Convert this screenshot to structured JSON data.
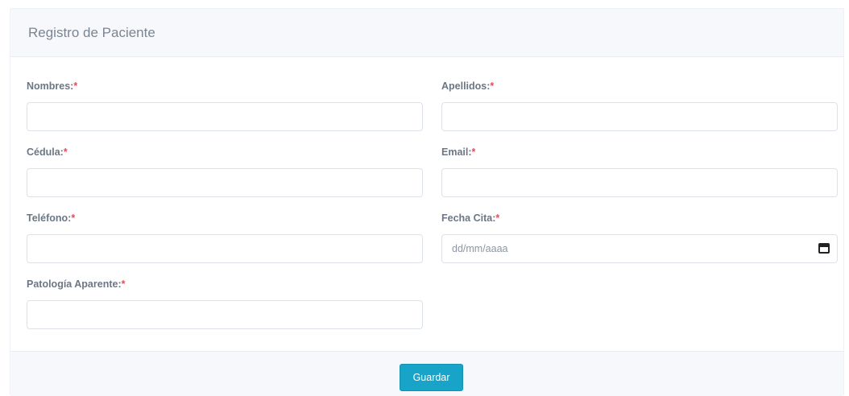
{
  "header": {
    "title": "Registro de Paciente"
  },
  "form": {
    "nombres": {
      "label": "Nombres:",
      "required_mark": "*",
      "value": ""
    },
    "apellidos": {
      "label": "Apellidos:",
      "required_mark": "*",
      "value": ""
    },
    "cedula": {
      "label": "Cédula:",
      "required_mark": "*",
      "value": ""
    },
    "email": {
      "label": "Email:",
      "required_mark": "*",
      "value": ""
    },
    "telefono": {
      "label": "Teléfono:",
      "required_mark": "*",
      "value": ""
    },
    "fecha_cita": {
      "label": "Fecha Cita:",
      "required_mark": "*",
      "placeholder": "dd/mm/aaaa"
    },
    "patologia": {
      "label": "Patología Aparente:",
      "required_mark": "*",
      "value": ""
    }
  },
  "footer": {
    "save_label": "Guardar"
  },
  "colors": {
    "accent": "#18a4c8",
    "required": "#e64b5a",
    "header_bg": "#f6f8fb"
  }
}
